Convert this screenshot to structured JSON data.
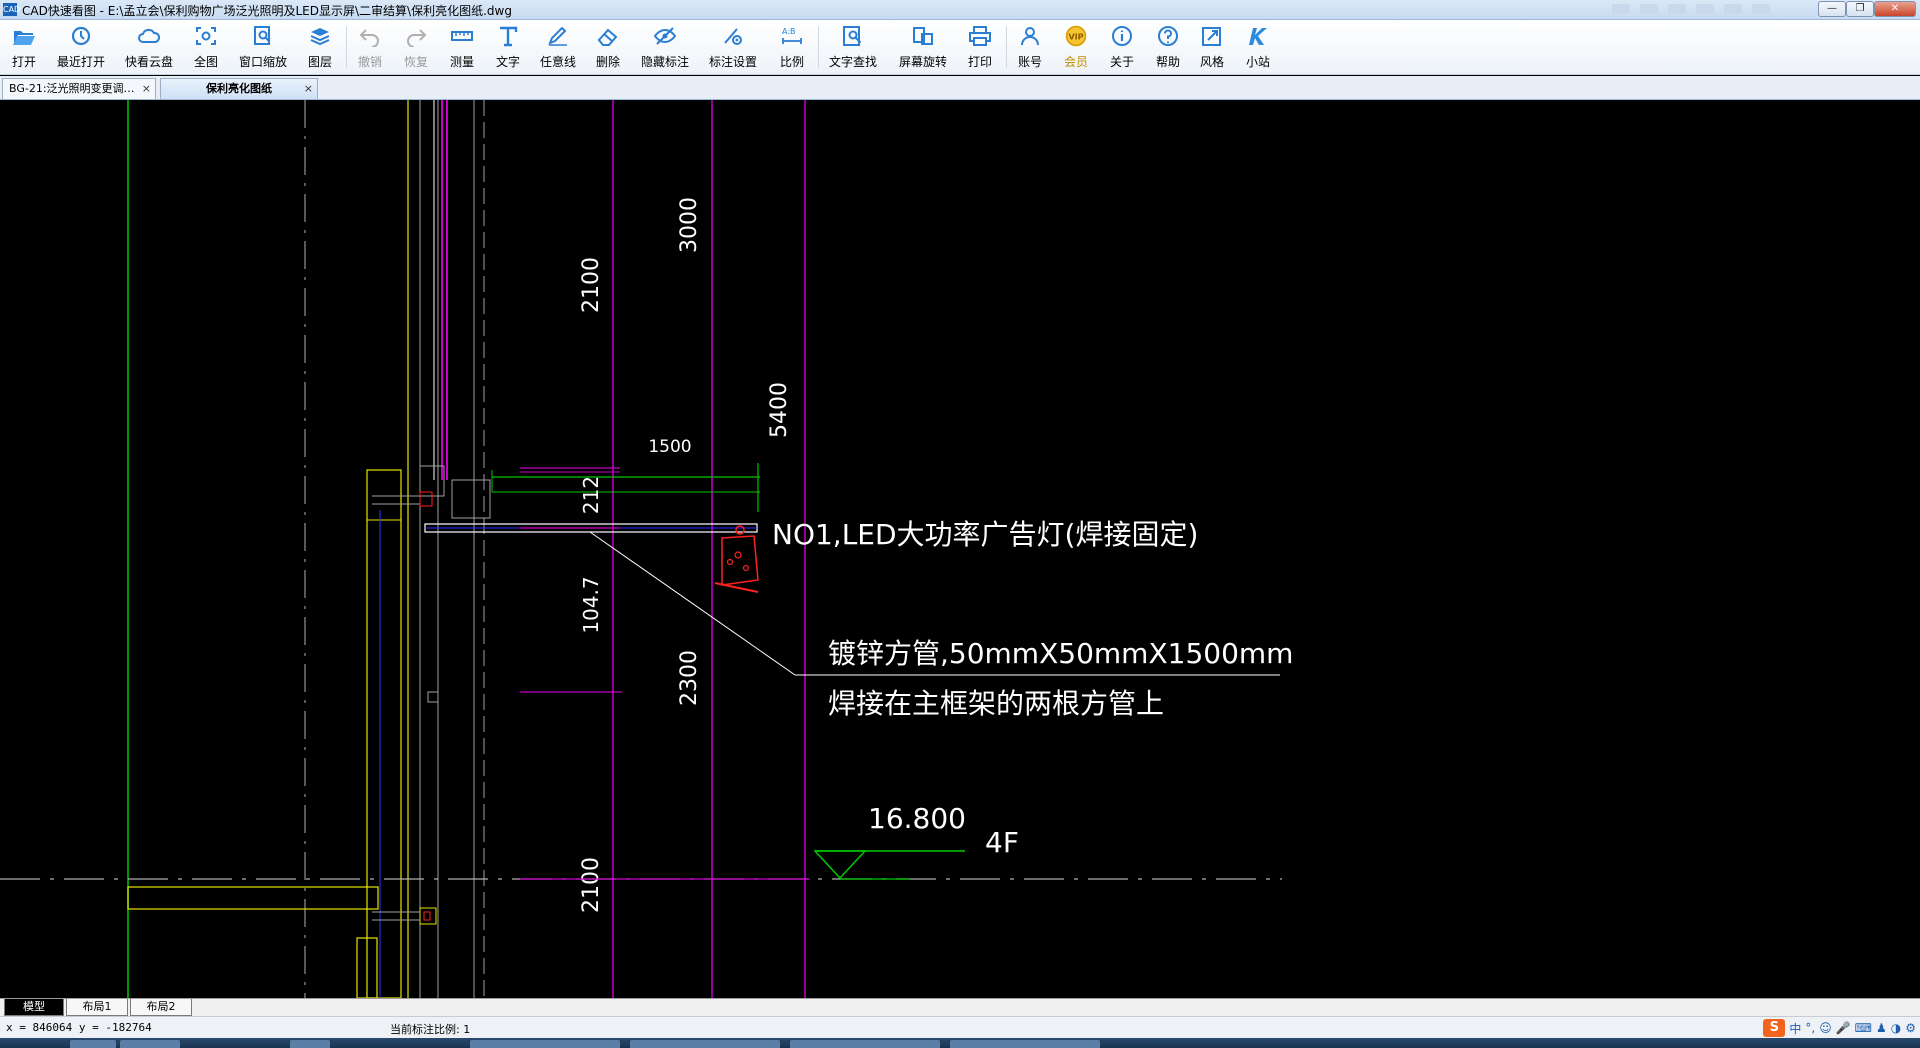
{
  "window": {
    "title": "CAD快速看图 - E:\\孟立会\\保利购物广场泛光照明及LED显示屏\\二审结算\\保利亮化图纸.dwg",
    "icon_label": "CAD"
  },
  "toolbar": {
    "items": [
      {
        "label": "打开",
        "icon": "folder-open-icon"
      },
      {
        "label": "最近打开",
        "icon": "recent-icon"
      },
      {
        "label": "快看云盘",
        "icon": "cloud-icon"
      },
      {
        "label": "全图",
        "icon": "fit-all-icon"
      },
      {
        "label": "窗口缩放",
        "icon": "window-zoom-icon"
      },
      {
        "label": "图层",
        "icon": "layers-icon"
      },
      {
        "label": "撤销",
        "icon": "undo-icon"
      },
      {
        "label": "恢复",
        "icon": "redo-icon"
      },
      {
        "label": "测量",
        "icon": "ruler-icon"
      },
      {
        "label": "文字",
        "icon": "text-icon"
      },
      {
        "label": "任意线",
        "icon": "pen-icon"
      },
      {
        "label": "删除",
        "icon": "eraser-icon"
      },
      {
        "label": "隐藏标注",
        "icon": "hide-eye-icon"
      },
      {
        "label": "标注设置",
        "icon": "dimension-settings-icon"
      },
      {
        "label": "比例",
        "icon": "scale-icon"
      },
      {
        "label": "文字查找",
        "icon": "text-search-icon"
      },
      {
        "label": "屏幕旋转",
        "icon": "rotate-screen-icon"
      },
      {
        "label": "打印",
        "icon": "printer-icon"
      },
      {
        "label": "账号",
        "icon": "user-icon"
      },
      {
        "label": "会员",
        "icon": "vip-icon"
      },
      {
        "label": "关于",
        "icon": "info-icon"
      },
      {
        "label": "帮助",
        "icon": "help-icon"
      },
      {
        "label": "风格",
        "icon": "style-icon"
      },
      {
        "label": "小站",
        "icon": "k-logo-icon"
      }
    ]
  },
  "tabs": [
    {
      "label": "BG-21:泛光照明变更调…",
      "close": "×"
    },
    {
      "label": "保利亮化图纸",
      "close": "×"
    }
  ],
  "drawing": {
    "dims": {
      "d3000": "3000",
      "d2100_top": "2100",
      "d5400": "5400",
      "d1500": "1500",
      "d212": "212",
      "d1047": "104.7",
      "d2300": "2300",
      "d2100_bottom": "2100"
    },
    "annotation_led": "NO1,LED大功率广告灯(焊接固定)",
    "annotation_pipe_line1": "镀锌方管,50mmX50mmX1500mm",
    "annotation_pipe_line2": "焊接在主框架的两根方管上",
    "elevation_value": "16.800",
    "floor_label": "4F",
    "colors": {
      "magenta": "#c800c8",
      "yellow": "#e6e600",
      "green": "#00c800",
      "white": "#ffffff",
      "gray": "#a0a0a0",
      "red": "#ff2020",
      "blue": "#3030ff"
    }
  },
  "layout_tabs": [
    "模型",
    "布局1",
    "布局2"
  ],
  "status": {
    "coords": "x = 846064 y = -182764",
    "scale_text": "当前标注比例: 1"
  },
  "ime": {
    "logo": "S",
    "mode": "中",
    "punct": "°,"
  }
}
